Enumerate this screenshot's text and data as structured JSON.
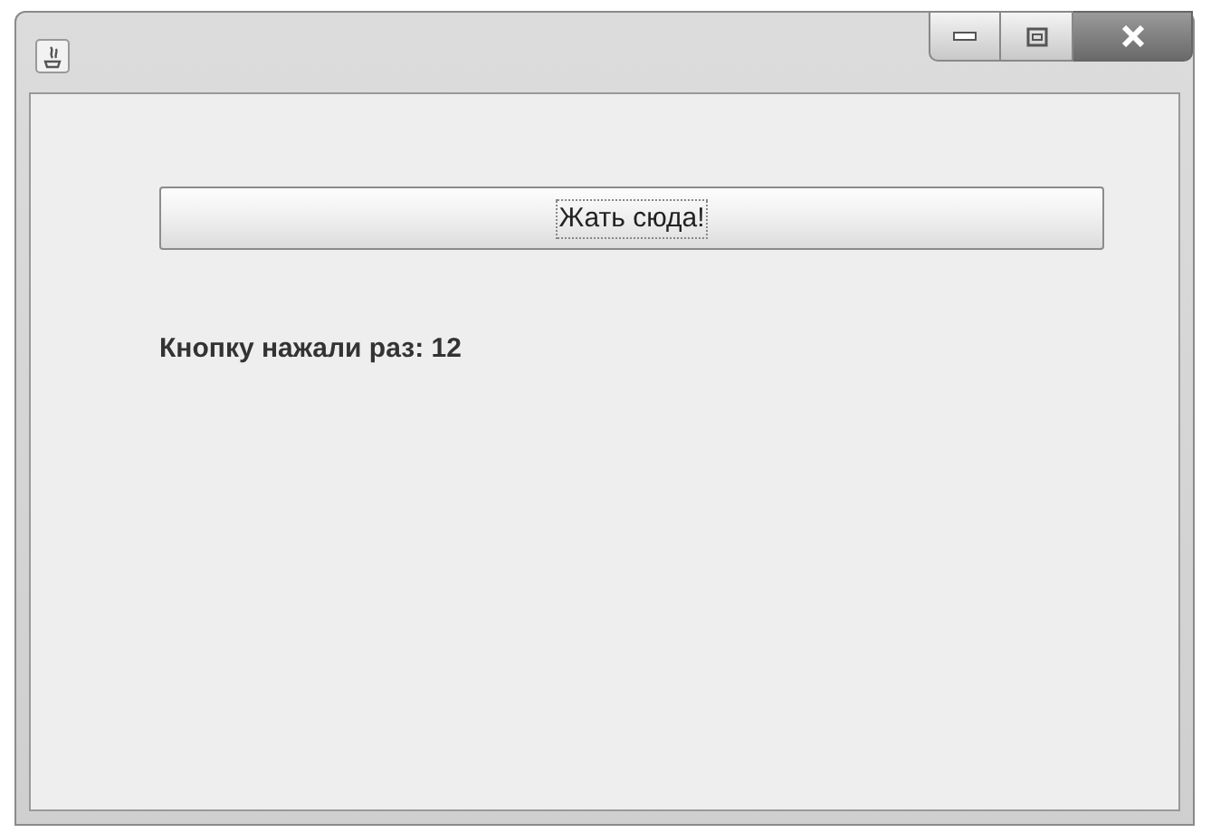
{
  "button": {
    "label": "Жать сюда!",
    "focused": true
  },
  "counter_label": "Кнопку нажали раз: 12"
}
